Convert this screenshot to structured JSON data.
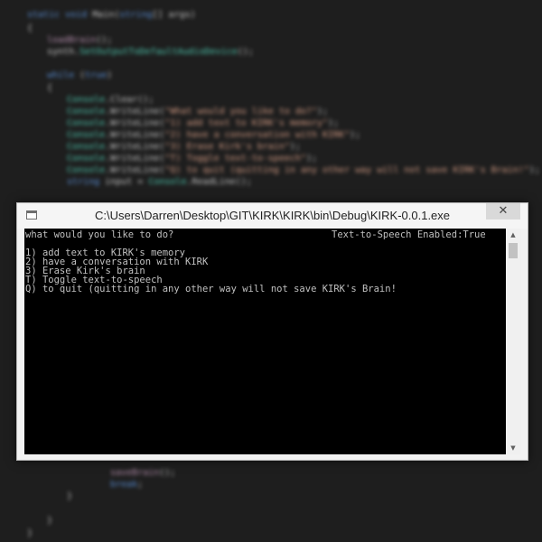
{
  "editor": {
    "lines": [
      {
        "parts": [
          {
            "c": "kw",
            "t": "static void "
          },
          {
            "c": "pl",
            "t": "Main"
          },
          {
            "c": "pl",
            "t": "("
          },
          {
            "c": "kw",
            "t": "string"
          },
          {
            "c": "pl",
            "t": "[] args)"
          }
        ]
      },
      {
        "parts": [
          {
            "c": "pl",
            "t": "{"
          }
        ]
      },
      {
        "parts": [
          {
            "c": "mt",
            "t": "loadBrain"
          },
          {
            "c": "pl",
            "t": "();"
          }
        ]
      },
      {
        "parts": [
          {
            "c": "pl",
            "t": "synth."
          },
          {
            "c": "ty",
            "t": "SetOutputToDefaultAudioDevice"
          },
          {
            "c": "pl",
            "t": "();"
          }
        ]
      },
      {
        "parts": [
          {
            "c": "pl",
            "t": ""
          }
        ]
      },
      {
        "parts": [
          {
            "c": "kw",
            "t": "while "
          },
          {
            "c": "pl",
            "t": "("
          },
          {
            "c": "kw",
            "t": "true"
          },
          {
            "c": "pl",
            "t": ")"
          }
        ]
      },
      {
        "parts": [
          {
            "c": "pl",
            "t": "{"
          }
        ]
      },
      {
        "parts": [
          {
            "c": "ty",
            "t": "Console"
          },
          {
            "c": "pl",
            "t": ".Clear();"
          }
        ]
      },
      {
        "parts": [
          {
            "c": "ty",
            "t": "Console"
          },
          {
            "c": "pl",
            "t": ".WriteLine("
          },
          {
            "c": "st",
            "t": "\"What would you like to do?\""
          },
          {
            "c": "pl",
            "t": ");"
          }
        ]
      },
      {
        "parts": [
          {
            "c": "ty",
            "t": "Console"
          },
          {
            "c": "pl",
            "t": ".WriteLine("
          },
          {
            "c": "st",
            "t": "\"1) add text to KIRK's memory\""
          },
          {
            "c": "pl",
            "t": ");"
          }
        ]
      },
      {
        "parts": [
          {
            "c": "ty",
            "t": "Console"
          },
          {
            "c": "pl",
            "t": ".WriteLine("
          },
          {
            "c": "st",
            "t": "\"2) have a conversation with KIRK\""
          },
          {
            "c": "pl",
            "t": ");"
          }
        ]
      },
      {
        "parts": [
          {
            "c": "ty",
            "t": "Console"
          },
          {
            "c": "pl",
            "t": ".WriteLine("
          },
          {
            "c": "st",
            "t": "\"3) Erase Kirk's brain\""
          },
          {
            "c": "pl",
            "t": ");"
          }
        ]
      },
      {
        "parts": [
          {
            "c": "ty",
            "t": "Console"
          },
          {
            "c": "pl",
            "t": ".WriteLine("
          },
          {
            "c": "st",
            "t": "\"T) Toggle text-to-speech\""
          },
          {
            "c": "pl",
            "t": ");"
          }
        ]
      },
      {
        "parts": [
          {
            "c": "ty",
            "t": "Console"
          },
          {
            "c": "pl",
            "t": ".WriteLine("
          },
          {
            "c": "st",
            "t": "\"Q) to quit (quitting in any other way will not save KIRK's Brain!\""
          },
          {
            "c": "pl",
            "t": ");"
          }
        ]
      },
      {
        "parts": [
          {
            "c": "kw",
            "t": "string "
          },
          {
            "c": "pl",
            "t": "input = "
          },
          {
            "c": "ty",
            "t": "Console"
          },
          {
            "c": "pl",
            "t": ".ReadLine();"
          }
        ]
      }
    ],
    "tail_lines": [
      {
        "parts": [
          {
            "c": "pl",
            "t": "what would you like to do?"
          }
        ]
      },
      {
        "parts": [
          {
            "c": "mt",
            "t": "saveBrain"
          },
          {
            "c": "pl",
            "t": "();"
          }
        ]
      },
      {
        "parts": [
          {
            "c": "kw",
            "t": "break"
          },
          {
            "c": "pl",
            "t": ";"
          }
        ]
      },
      {
        "parts": [
          {
            "c": "pl",
            "t": "}"
          }
        ]
      },
      {
        "parts": [
          {
            "c": "pl",
            "t": "}"
          }
        ]
      },
      {
        "parts": [
          {
            "c": "pl",
            "t": "}"
          }
        ]
      }
    ]
  },
  "console_window": {
    "title": "C:\\Users\\Darren\\Desktop\\GIT\\KIRK\\KIRK\\bin\\Debug\\KIRK-0.0.1.exe",
    "close_glyph": "✕",
    "status": "Text-to-Speech Enabled:True",
    "prompt": "what would you like to do?",
    "menu_items": [
      "1) add text to KIRK's memory",
      "2) have a conversation with KIRK",
      "3) Erase Kirk's brain",
      "T) Toggle text-to-speech",
      "Q) to quit (quitting in any other way will not save KIRK's Brain!"
    ],
    "scroll_up_glyph": "▲",
    "scroll_down_glyph": "▼"
  }
}
